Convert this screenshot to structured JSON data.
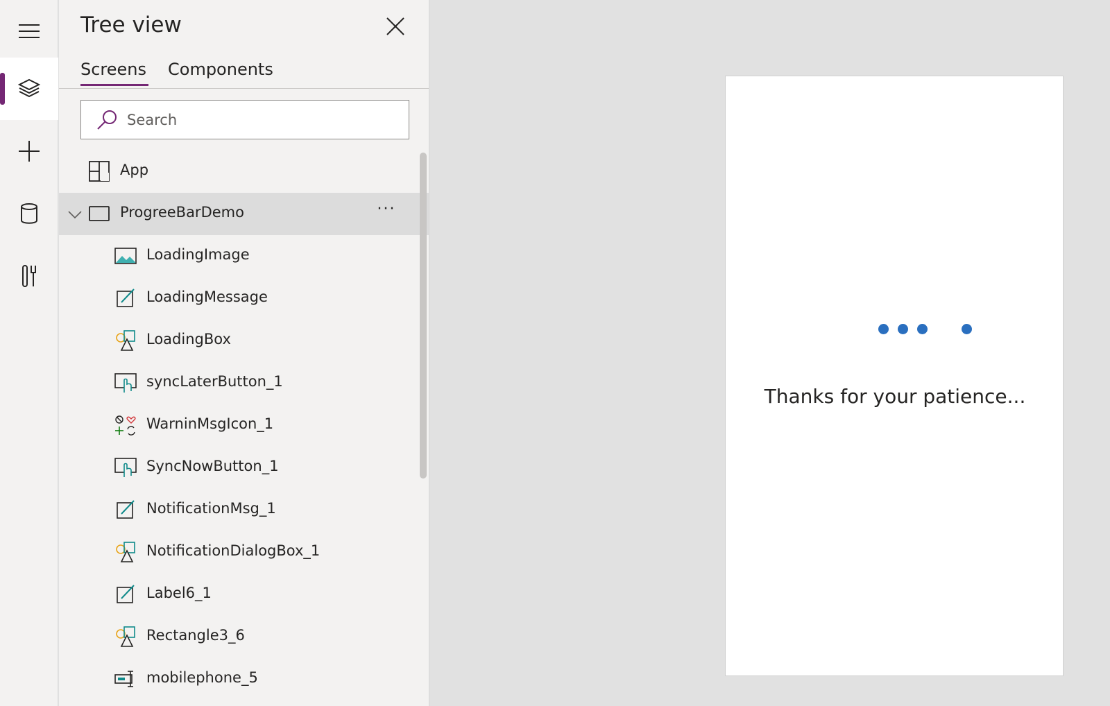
{
  "rail": {
    "items": [
      {
        "name": "menu",
        "icon": "hamburger-icon"
      },
      {
        "name": "tree-view",
        "icon": "layers-icon",
        "active": true
      },
      {
        "name": "insert",
        "icon": "plus-icon"
      },
      {
        "name": "data",
        "icon": "database-icon"
      },
      {
        "name": "tools",
        "icon": "tools-icon"
      }
    ],
    "accent": "#742774"
  },
  "panel": {
    "title": "Tree view",
    "tabs": [
      {
        "label": "Screens",
        "active": true
      },
      {
        "label": "Components",
        "active": false
      }
    ],
    "search": {
      "placeholder": "Search",
      "value": ""
    }
  },
  "tree": {
    "app": {
      "label": "App",
      "icon": "app-icon"
    },
    "screen": {
      "label": "ProgreeBarDemo",
      "icon": "screen-icon",
      "more": "···",
      "expanded": true
    },
    "children": [
      {
        "label": "LoadingImage",
        "icon": "image-icon"
      },
      {
        "label": "LoadingMessage",
        "icon": "label-icon"
      },
      {
        "label": "LoadingBox",
        "icon": "shape-icon"
      },
      {
        "label": "syncLaterButton_1",
        "icon": "button-icon"
      },
      {
        "label": "WarninMsgIcon_1",
        "icon": "icons-icon"
      },
      {
        "label": "SyncNowButton_1",
        "icon": "button-icon"
      },
      {
        "label": "NotificationMsg_1",
        "icon": "label-icon"
      },
      {
        "label": "NotificationDialogBox_1",
        "icon": "shape-icon"
      },
      {
        "label": "Label6_1",
        "icon": "label-icon"
      },
      {
        "label": "Rectangle3_6",
        "icon": "shape-icon"
      },
      {
        "label": "mobilephone_5",
        "icon": "text-input-icon"
      }
    ]
  },
  "canvas": {
    "message": "Thanks for your patience...",
    "dot_color": "#2a6fbf"
  }
}
